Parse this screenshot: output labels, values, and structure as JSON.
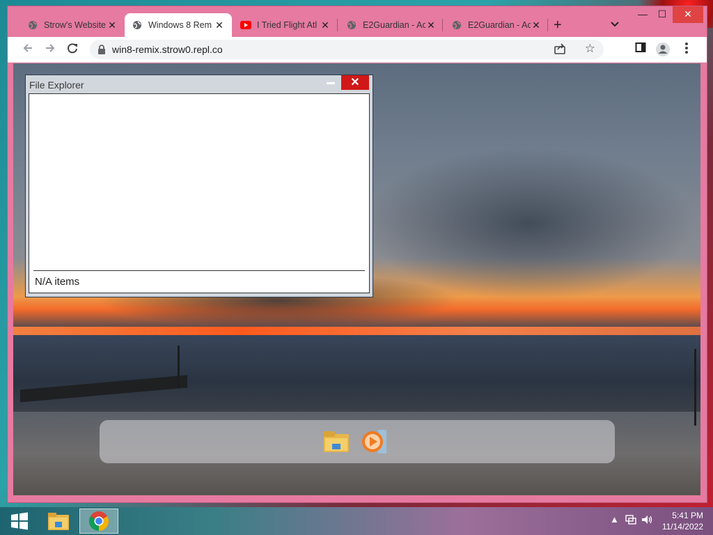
{
  "browser": {
    "tabs": [
      {
        "title": "Strow's Website",
        "favicon": "globe-icon",
        "active": false
      },
      {
        "title": "Windows 8 Rem",
        "favicon": "globe-icon",
        "active": true
      },
      {
        "title": "I Tried Flight Atl",
        "favicon": "youtube-icon",
        "active": false
      },
      {
        "title": "E2Guardian - Ac",
        "favicon": "globe-icon",
        "active": false
      },
      {
        "title": "E2Guardian - Ac",
        "favicon": "globe-icon",
        "active": false
      }
    ],
    "close_glyph": "✕",
    "new_tab_glyph": "+",
    "url": "win8-remix.strow0.repl.co",
    "window_controls": {
      "minimize": "—",
      "maximize": "☐",
      "close": "✕"
    }
  },
  "file_explorer": {
    "title": "File Explorer",
    "status": "N/A items",
    "close_glyph": "✕"
  },
  "dock": {
    "icons": [
      "folder-icon",
      "media-player-icon"
    ]
  },
  "taskbar": {
    "time": "5:41 PM",
    "date": "11/14/2022",
    "items": [
      "start-button",
      "file-explorer-icon",
      "chrome-icon"
    ]
  },
  "colors": {
    "chrome_frame": "#e67aa0",
    "explorer_close": "#d11818"
  }
}
